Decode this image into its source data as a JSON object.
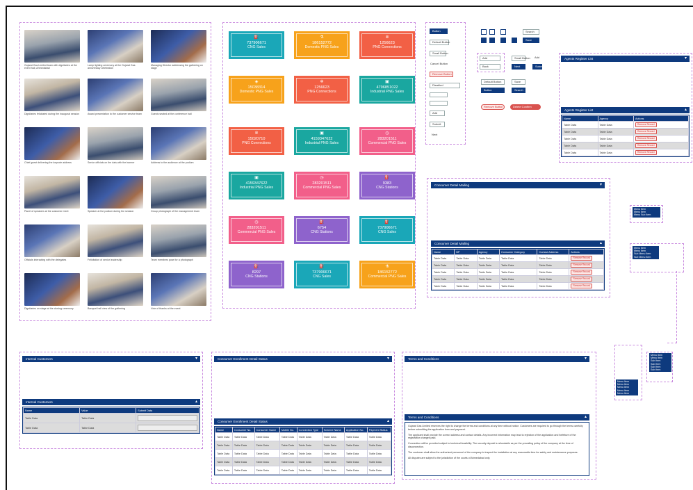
{
  "gallery": {
    "items": [
      {
        "caption": "Gujarat Gas Limited team with dignitaries at the event hall, Ahmedabad"
      },
      {
        "caption": "Lamp lighting ceremony at the Gujarat Gas anniversary celebration"
      },
      {
        "caption": "Managing Director addressing the gathering on stage"
      },
      {
        "caption": "Dignitaries felicitated during the inaugural session"
      },
      {
        "caption": "Award presentation to the customer service team"
      },
      {
        "caption": "Guests seated at the conference hall"
      },
      {
        "caption": "Chief guest delivering the keynote address"
      },
      {
        "caption": "Senior officials on the dais with the banner"
      },
      {
        "caption": "Address to the audience at the podium"
      },
      {
        "caption": "Panel of speakers at the customer meet"
      },
      {
        "caption": "Speaker at the podium during the session"
      },
      {
        "caption": "Group photograph of the management team"
      },
      {
        "caption": "Officials interacting with the delegates"
      },
      {
        "caption": "Felicitation of senior leadership"
      },
      {
        "caption": "Team members pose for a photograph"
      },
      {
        "caption": "Dignitaries on stage at the closing ceremony"
      },
      {
        "caption": "Banquet hall view of the gathering"
      },
      {
        "caption": "Vote of thanks at the event"
      }
    ]
  },
  "stats": [
    {
      "icon": "pump-icon",
      "glyph": "⛽",
      "value": "737906671",
      "label": "CNG Sales",
      "color": "#1aa7b8"
    },
    {
      "icon": "flask-icon",
      "glyph": "⚗",
      "value": "186152772",
      "label": "Domestic PNG Sales",
      "color": "#f7a21b"
    },
    {
      "icon": "gear-icon",
      "glyph": "✲",
      "value": "1256623",
      "label": "PNG Connections",
      "color": "#f26045"
    },
    {
      "icon": "cube-icon",
      "glyph": "◈",
      "value": "15038314",
      "label": "Domestic PNG Sales",
      "color": "#f7a21b"
    },
    {
      "icon": "gear-icon",
      "glyph": "✲",
      "value": "1256623",
      "label": "PNG Connections",
      "color": "#f26045"
    },
    {
      "icon": "factory-icon",
      "glyph": "▣",
      "value": "4796851022",
      "label": "Industrial PNG Sales",
      "color": "#1aa7a0"
    },
    {
      "icon": "gear-icon",
      "glyph": "✲",
      "value": "15020710",
      "label": "PNG Connections",
      "color": "#f26045"
    },
    {
      "icon": "factory-icon",
      "glyph": "▣",
      "value": "4159347622",
      "label": "Industrial PNG Sales",
      "color": "#1aa7a0"
    },
    {
      "icon": "clock-icon",
      "glyph": "◷",
      "value": "283201511",
      "label": "Commercial PNG Sales",
      "color": "#f25f8a"
    },
    {
      "icon": "factory-icon",
      "glyph": "▣",
      "value": "4159347622",
      "label": "Industrial PNG Sales",
      "color": "#1aa7a0"
    },
    {
      "icon": "clock-icon",
      "glyph": "◷",
      "value": "283201511",
      "label": "Commercial PNG Sales",
      "color": "#f25f8a"
    },
    {
      "icon": "station-icon",
      "glyph": "⛽",
      "value": "9383",
      "label": "CNG Stations",
      "color": "#8e63cc"
    },
    {
      "icon": "clock-icon",
      "glyph": "◷",
      "value": "283201511",
      "label": "Commercial PNG Sales",
      "color": "#f25f8a"
    },
    {
      "icon": "station-icon",
      "glyph": "⛽",
      "value": "6754",
      "label": "CNG Stations",
      "color": "#8e63cc"
    },
    {
      "icon": "pump-icon",
      "glyph": "⛽",
      "value": "737906671",
      "label": "CNG Sales",
      "color": "#1aa7b8"
    },
    {
      "icon": "station-icon",
      "glyph": "⛽",
      "value": "8297",
      "label": "CNG Stations",
      "color": "#8e63cc"
    },
    {
      "icon": "pump-icon",
      "glyph": "⛽",
      "value": "737906671",
      "label": "CNG Sales",
      "color": "#1aa7b8"
    },
    {
      "icon": "flask-icon",
      "glyph": "⚗",
      "value": "186152772",
      "label": "Commercial PNG Sales",
      "color": "#f7a21b"
    }
  ],
  "buttons": {
    "primary": "Button",
    "default": "Default Button",
    "small": "Small Button",
    "cancel": "Cancel Button",
    "remove": "Remove Button",
    "disabled": "Disabled",
    "add": "Add",
    "submit": "Submit",
    "delete_confirm": "Delete Confirm",
    "save": "Save",
    "search": "Search",
    "next": "Next",
    "back": "Back"
  },
  "panel_top_right": {
    "collapsed_title": "Agents Register List",
    "expanded_title": "Agents Register List",
    "columns": [
      "Name",
      "Agency",
      "Actions"
    ],
    "rows": [
      {
        "name": "Table Data",
        "agency": "Table Data",
        "action": "Remove Record"
      },
      {
        "name": "Table Data",
        "agency": "Table Data",
        "action": "Remove Record"
      },
      {
        "name": "Table Data",
        "agency": "Table Data",
        "action": "Remove Record"
      },
      {
        "name": "Table Data",
        "agency": "Table Data",
        "action": "Remove Record"
      },
      {
        "name": "Table Data",
        "agency": "Table Data",
        "action": "Remove Record"
      }
    ]
  },
  "panel_mid": {
    "collapsed_title": "Consumer Detail Mailing",
    "expanded_title": "Consumer Detail Mailing",
    "columns": [
      "Name",
      "BP",
      "Agency",
      "Consumer Category",
      "Contact Address",
      "Actions"
    ],
    "rows": [
      {
        "c": [
          "Table Data",
          "Table Data",
          "Table Data",
          "Table Data",
          "Table Data"
        ],
        "action": "Remove Record"
      },
      {
        "c": [
          "Table Data",
          "Table Data",
          "Table Data",
          "Table Data",
          "Table Data"
        ],
        "action": "Remove Record"
      },
      {
        "c": [
          "Table Data",
          "Table Data",
          "Table Data",
          "Table Data",
          "Table Data"
        ],
        "action": "Remove Record"
      },
      {
        "c": [
          "Table Data",
          "Table Data",
          "Table Data",
          "Table Data",
          "Table Data"
        ],
        "action": "Remove Record"
      },
      {
        "c": [
          "Table Data",
          "Table Data",
          "Table Data",
          "Table Data",
          "Table Data"
        ],
        "action": "Remove Record"
      }
    ]
  },
  "panel_bl": {
    "collapsed_title": "Internal Customers",
    "expanded_title": "Internal Customers",
    "columns": [
      "Name",
      "Value",
      "Submit Data"
    ],
    "rows": [
      {
        "name": "Table Data",
        "value": "Table Data"
      },
      {
        "name": "Table Data",
        "value": "Table Data"
      }
    ]
  },
  "panel_bm": {
    "collapsed_title": "Consumer Enrollment Detail Status",
    "expanded_title": "Consumer Enrollment Detail Status",
    "columns": [
      "Name",
      "Consumer No.",
      "Consumer Name",
      "Mobile No.",
      "Connection Type",
      "Scheme Name",
      "Application No.",
      "Payment Status"
    ],
    "rows": [
      {
        "c": [
          "Table Data",
          "Table Data",
          "Table Data",
          "Table Data",
          "Table Data",
          "Table Data",
          "Table Data",
          "Table Data"
        ]
      },
      {
        "c": [
          "Table Data",
          "Table Data",
          "Table Data",
          "Table Data",
          "Table Data",
          "Table Data",
          "Table Data",
          "Table Data"
        ]
      },
      {
        "c": [
          "Table Data",
          "Table Data",
          "Table Data",
          "Table Data",
          "Table Data",
          "Table Data",
          "Table Data",
          "Table Data"
        ]
      },
      {
        "c": [
          "Table Data",
          "Table Data",
          "Table Data",
          "Table Data",
          "Table Data",
          "Table Data",
          "Table Data",
          "Table Data"
        ]
      },
      {
        "c": [
          "Table Data",
          "Table Data",
          "Table Data",
          "Table Data",
          "Table Data",
          "Table Data",
          "Table Data",
          "Table Data"
        ]
      }
    ]
  },
  "panel_br": {
    "collapsed_title": "Terms and Conditions",
    "expanded_title": "Terms and Conditions",
    "paragraphs": [
      "Gujarat Gas Limited reserves the right to change the terms and conditions at any time without notice. Customers are required to go through the terms carefully before submitting the application form and payment.",
      "The applicant shall provide the correct address and contact details. Any incorrect information may lead to rejection of the application and forfeiture of the registration charges paid.",
      "Connection will be provided subject to technical feasibility. The security deposit is refundable as per the prevailing policy of the company at the time of disconnection.",
      "The customer shall allow the authorised personnel of the company to inspect the installation at any reasonable time for safety and maintenance purposes.",
      "All disputes are subject to the jurisdiction of the courts of Ahmedabad only."
    ]
  },
  "side_menus": {
    "menu_a": [
      "Menu Item",
      "Menu Item",
      "Menu Sub Item"
    ],
    "menu_b": [
      "Menu Item",
      "Menu Item",
      "Sub Menu Item",
      "Sub Menu Item"
    ],
    "menu_c": [
      "Menu Item",
      "Menu Item",
      "Sub Item",
      "Sub Item",
      "Sub Item",
      "Sub Item"
    ],
    "menu_d": [
      "Menu Item",
      "Menu Item",
      "Menu Item",
      "Menu Item",
      "Menu Item"
    ]
  },
  "colors": {
    "primary": "#0e3a7e",
    "accent_red": "#d9534f",
    "row_alt": "#dcdcdc"
  }
}
